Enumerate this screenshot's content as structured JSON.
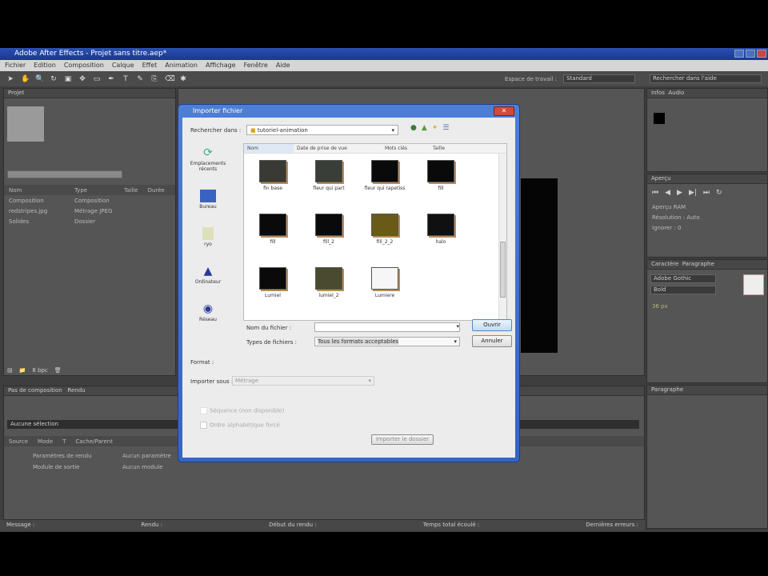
{
  "app": {
    "title": "Adobe After Effects - Projet sans titre.aep*",
    "menu": [
      "Fichier",
      "Edition",
      "Composition",
      "Calque",
      "Effet",
      "Animation",
      "Affichage",
      "Fenêtre",
      "Aide"
    ],
    "workspace_label": "Espace de travail :",
    "workspace_value": "Standard",
    "search_help": "Rechercher dans l'aide"
  },
  "project": {
    "tab": "Projet",
    "columns": [
      "Nom",
      "Type",
      "Taille",
      "Durée"
    ],
    "items": [
      {
        "name": "Composition",
        "type": "Composition"
      },
      {
        "name": "redstripes.jpg",
        "type": "Métrage JPEG"
      },
      {
        "name": "Solides",
        "type": "Dossier"
      }
    ],
    "bpc": "8 bpc"
  },
  "timeline": {
    "tab": "Pas de composition",
    "tab2": "Rendu",
    "current": "Aucune sélection",
    "columns": [
      "Source",
      "Mode",
      "T",
      "Cache/Parent"
    ],
    "rows": [
      "Paramètres de rendu",
      "Module de sortie"
    ],
    "row_values": [
      "Aucun paramètre",
      "Aucun module"
    ]
  },
  "status": [
    "Message :",
    "Rendu :",
    "Début du rendu :",
    "Temps total écoulé :",
    "Dernières erreurs :"
  ],
  "right": {
    "info_tab": "Infos",
    "audio_tab": "Audio",
    "preview_tab": "Aperçu",
    "character_tab": "Caractère",
    "paragraph_tab": "Paragraphe",
    "preview_options": [
      "Aperçu RAM",
      "Résolution : Auto",
      "Ignorer : 0"
    ],
    "font": "Adobe Gothic",
    "style": "Bold",
    "size": "36 px"
  },
  "dialog": {
    "title": "Importer fichier",
    "look_in_label": "Rechercher dans :",
    "look_in_value": "tutoriel-animation",
    "columns": [
      "Nom",
      "Date de prise de vue",
      "Mots clés",
      "Taille"
    ],
    "places": [
      "Emplacements récents",
      "Bureau",
      "ryo",
      "Ordinateur",
      "Réseau"
    ],
    "files": [
      "fin base",
      "fleur qui part",
      "fleur qui rapetiss",
      "fill",
      "fill",
      "fill_2",
      "fill_2_2",
      "halo",
      "Lumiel",
      "lumiel_2",
      "Lumiere"
    ],
    "filename_label": "Nom du fichier :",
    "filename_value": "",
    "filetype_label": "Types de fichiers :",
    "filetype_value": "Tous les formats acceptables",
    "open": "Ouvrir",
    "cancel": "Annuler",
    "format_label": "Format :",
    "import_as_label": "Importer sous :",
    "import_as_value": "Métrage",
    "sequence": "Séquence (non disponible)",
    "alpha": "Ordre alphabétique forcé",
    "import_folder": "Importer le dossier"
  }
}
